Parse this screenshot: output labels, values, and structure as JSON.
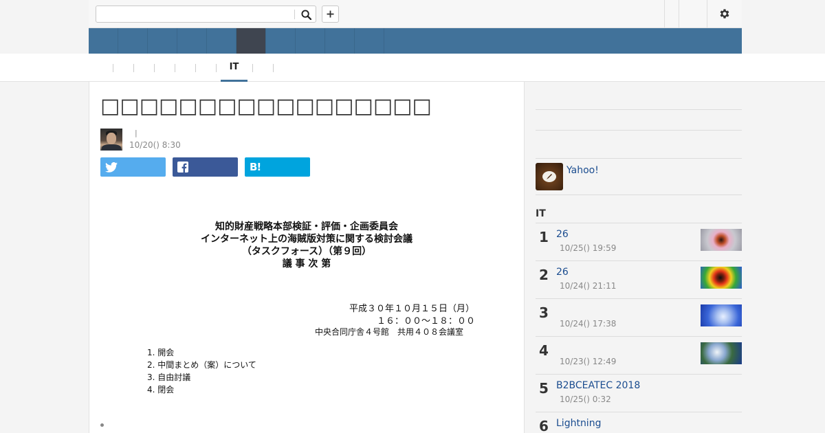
{
  "header": {
    "search": {
      "value": "",
      "placeholder": ""
    },
    "icons": {
      "search": "search-icon",
      "add": "plus-icon",
      "settings": "gear-icon"
    }
  },
  "subnav": {
    "active_tab": "IT"
  },
  "article": {
    "headline": "□□□□□□□□□□□□□□□□□",
    "byline_sep": "|",
    "timestamp": "10/20() 8:30",
    "share": {
      "hatena_label": "B!"
    },
    "document": {
      "title_lines": [
        "知的財産戦略本部検証・評価・企画委員会",
        "インターネット上の海賊版対策に関する検討会議",
        "（タスクフォース）（第９回）",
        "議 事 次 第"
      ],
      "date": "平成３０年１０月１５日（月）",
      "time": "１６：００～１８：００",
      "venue": "中央合同庁舎４号館　共用４０８会議室",
      "agenda": [
        "1. 開会",
        "2. 中間まとめ（案）について",
        "3. 自由討議",
        "4. 閉会"
      ]
    }
  },
  "sidebar": {
    "yahoo_label": "Yahoo!",
    "ranking_heading": "IT",
    "ranking": [
      {
        "rank": "1",
        "title": "26",
        "time": "10/25() 19:59"
      },
      {
        "rank": "2",
        "title": "26",
        "time": "10/24() 21:11"
      },
      {
        "rank": "3",
        "title": "",
        "time": "10/24() 17:38"
      },
      {
        "rank": "4",
        "title": "",
        "time": "10/23() 12:49"
      },
      {
        "rank": "5",
        "title": "B2BCEATEC 2018",
        "time": "10/25() 0:32"
      },
      {
        "rank": "6",
        "title": "Lightning",
        "time": ""
      }
    ]
  },
  "colors": {
    "nav_bar": "#41729a",
    "nav_active": "#3f4550",
    "twitter": "#55acee",
    "facebook": "#3b5998",
    "hatena": "#00a4de",
    "link": "#1a4c8f"
  }
}
